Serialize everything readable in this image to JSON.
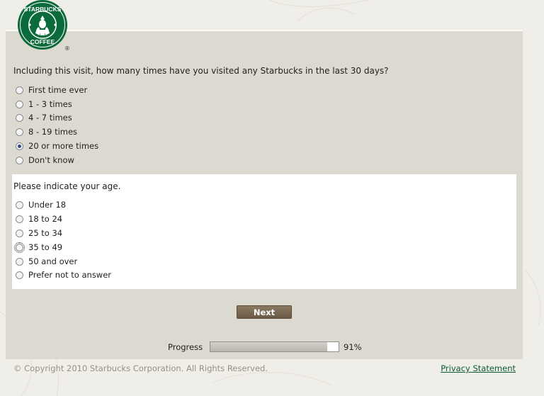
{
  "brand": {
    "logo_icon": "starbucks-coffee-logo",
    "logo_text_top": "STARBUCKS",
    "logo_text_bottom": "COFFEE",
    "logo_mark": "®",
    "brand_green": "#0b6b3a"
  },
  "question1": {
    "text": "Including this visit, how many times have you visited any Starbucks in the last 30 days?",
    "options": [
      {
        "label": "First time ever",
        "checked": false
      },
      {
        "label": "1 - 3 times",
        "checked": false
      },
      {
        "label": "4 - 7 times",
        "checked": false
      },
      {
        "label": "8 - 19 times",
        "checked": false
      },
      {
        "label": "20 or more times",
        "checked": true
      },
      {
        "label": "Don't know",
        "checked": false
      }
    ]
  },
  "question2": {
    "text": "Please indicate your age.",
    "options": [
      {
        "label": "Under 18",
        "checked": false
      },
      {
        "label": "18 to 24",
        "checked": false
      },
      {
        "label": "25 to 34",
        "checked": false
      },
      {
        "label": "35 to 49",
        "checked": false,
        "focused": true
      },
      {
        "label": "50 and over",
        "checked": false
      },
      {
        "label": "Prefer not to answer",
        "checked": false
      }
    ]
  },
  "next_label": "Next",
  "progress": {
    "label": "Progress",
    "value_text": "91%",
    "fraction": 0.91
  },
  "footer": {
    "copyright": "© Copyright 2010 Starbucks Corporation. All Rights Reserved.",
    "privacy_label": "Privacy Statement"
  }
}
